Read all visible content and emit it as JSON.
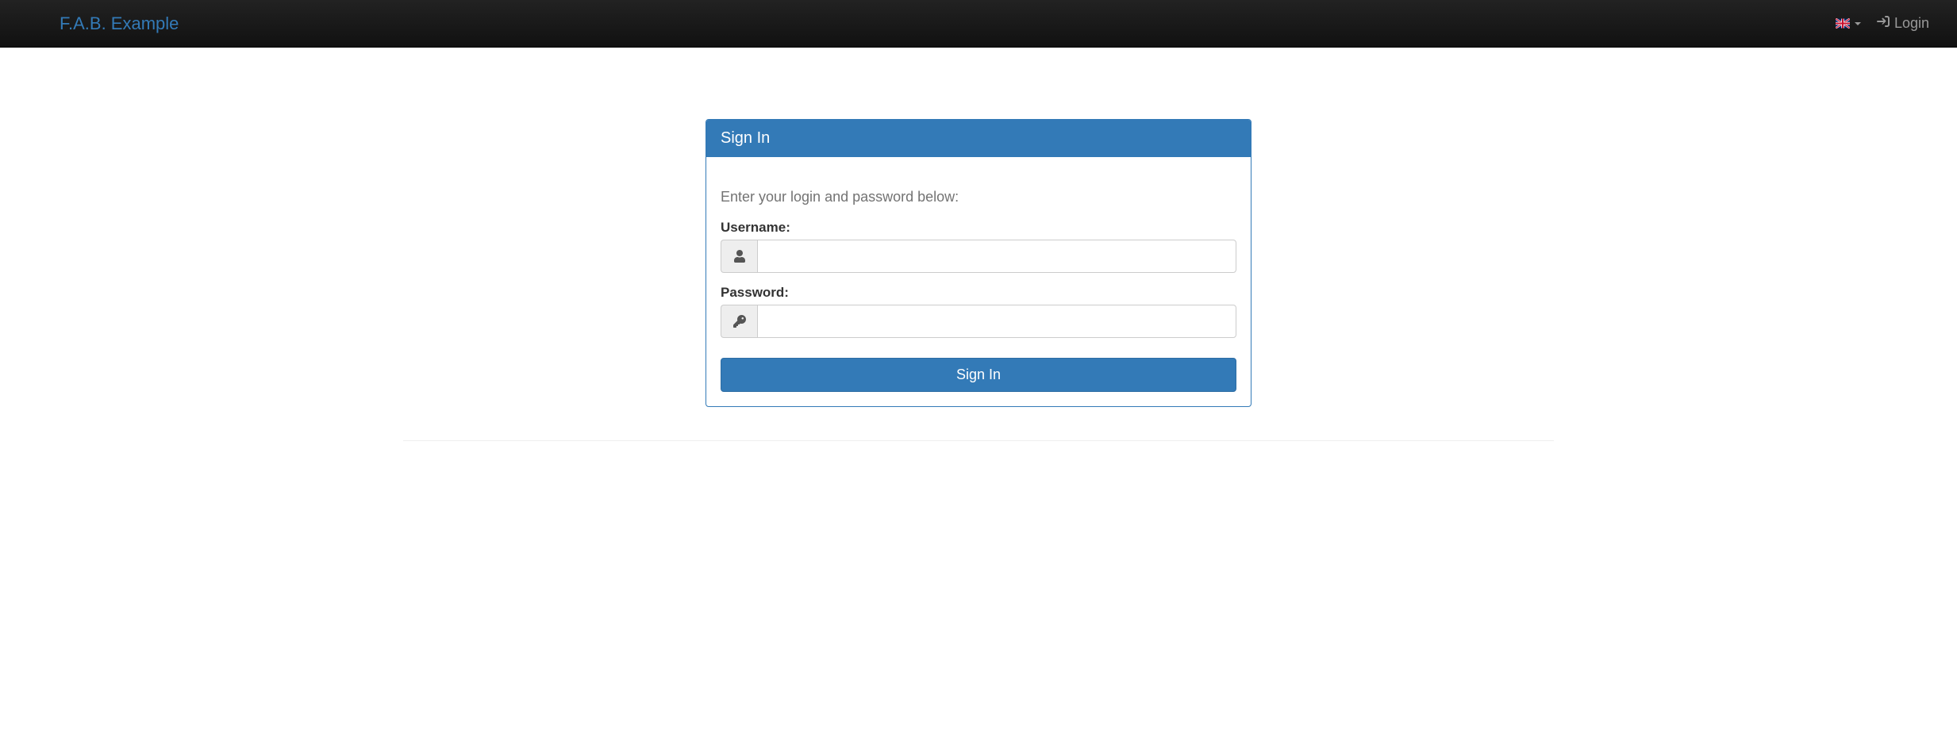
{
  "navbar": {
    "brand": "F.A.B. Example",
    "login_label": "Login"
  },
  "panel": {
    "title": "Sign In",
    "help_text": "Enter your login and password below:",
    "username_label": "Username:",
    "password_label": "Password:",
    "username_value": "",
    "password_value": "",
    "submit_label": "Sign In"
  }
}
